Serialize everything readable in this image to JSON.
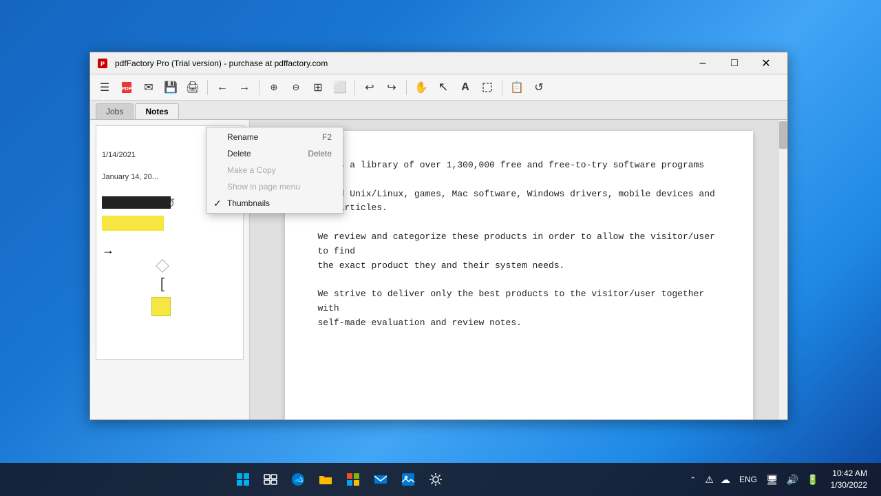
{
  "desktop": {},
  "titlebar": {
    "icon": "📄",
    "title": "pdfFactory Pro (Trial version) - purchase at pdffactory.com",
    "minimize": "–",
    "maximize": "□",
    "close": "✕"
  },
  "toolbar": {
    "buttons": [
      {
        "name": "menu-icon",
        "symbol": "☰"
      },
      {
        "name": "pdf-icon",
        "symbol": "📕"
      },
      {
        "name": "email-icon",
        "symbol": "✉"
      },
      {
        "name": "save-icon",
        "symbol": "💾"
      },
      {
        "name": "print-icon",
        "symbol": "🖨"
      },
      {
        "sep": true
      },
      {
        "name": "back-icon",
        "symbol": "←"
      },
      {
        "name": "forward-icon",
        "symbol": "→"
      },
      {
        "sep": true
      },
      {
        "name": "zoom-in-icon",
        "symbol": "🔍+"
      },
      {
        "name": "zoom-out-icon",
        "symbol": "🔍−"
      },
      {
        "name": "grid-icon",
        "symbol": "⊞"
      },
      {
        "name": "fit-icon",
        "symbol": "⬜"
      },
      {
        "sep": true
      },
      {
        "name": "undo-icon",
        "symbol": "↩"
      },
      {
        "name": "redo-icon",
        "symbol": "↪"
      },
      {
        "sep": true
      },
      {
        "name": "hand-icon",
        "symbol": "✋"
      },
      {
        "name": "select-icon",
        "symbol": "↖"
      },
      {
        "name": "text-icon",
        "symbol": "A"
      },
      {
        "name": "crop-icon",
        "symbol": "⬚"
      },
      {
        "sep": true
      },
      {
        "name": "copy-icon",
        "symbol": "📋"
      },
      {
        "name": "refresh-icon",
        "symbol": "↺"
      }
    ]
  },
  "tabs": {
    "items": [
      {
        "label": "Jobs",
        "active": false
      },
      {
        "label": "Notes",
        "active": true
      }
    ]
  },
  "context_menu": {
    "items": [
      {
        "label": "Rename",
        "shortcut": "F2",
        "checked": false,
        "disabled": false
      },
      {
        "label": "Delete",
        "shortcut": "Delete",
        "checked": false,
        "disabled": false
      },
      {
        "label": "Make a Copy",
        "shortcut": "",
        "checked": false,
        "disabled": true
      },
      {
        "label": "Show in page menu",
        "shortcut": "",
        "checked": false,
        "disabled": true
      },
      {
        "label": "Thumbnails",
        "shortcut": "",
        "checked": true,
        "disabled": false
      }
    ]
  },
  "document": {
    "paragraphs": [
      "ia is a library of over 1,300,000 free and free-to-try software programs for\ns and Unix/Linux, games, Mac software, Windows drivers, mobile devices and\nted articles.",
      "We review and categorize these products in order to allow the visitor/user to find\nthe exact product they and their system needs.",
      "We strive to deliver only the best products to the visitor/user together with\nself-made evaluation and review notes."
    ]
  },
  "thumbnail": {
    "date1": "1/14/2021",
    "date2": "January 14, 20..."
  },
  "taskbar": {
    "start_icon": "⊞",
    "icons": [
      "🪟",
      "📁",
      "🌐",
      "📂",
      "⊞",
      "✉",
      "🖼",
      "⚙"
    ],
    "tray": {
      "chevron": "⌃",
      "icons": [
        "⚠",
        "☁"
      ],
      "lang": "ENG",
      "sys_icons": [
        "🖥",
        "🔊",
        "🔋"
      ],
      "time": "10:42 AM",
      "date": "1/30/2022"
    }
  }
}
